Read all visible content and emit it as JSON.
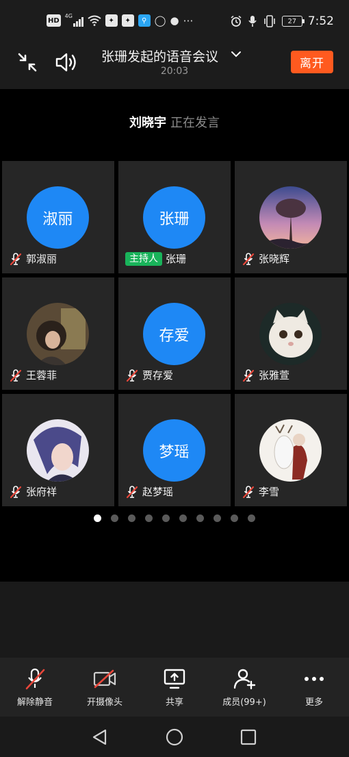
{
  "status_bar": {
    "time": "7:52",
    "battery": "27",
    "network": "4G",
    "hd_badge": "HD",
    "icons_left": [
      "hd-icon",
      "signal-icon",
      "wifi-icon",
      "app-notification-icon",
      "app-notification-icon",
      "search-app-icon",
      "security-app-icon",
      "chat-icon",
      "more-dots-icon"
    ],
    "icons_right": [
      "alarm-icon",
      "mic-icon",
      "vibrate-icon",
      "battery-icon"
    ]
  },
  "header": {
    "title": "张珊发起的语音会议",
    "timer": "20:03",
    "leave_label": "离开"
  },
  "speaker": {
    "name": "刘晓宇",
    "status": "正在发言"
  },
  "participants": [
    {
      "name": "郭淑丽",
      "avatar_text": "淑丽",
      "avatar_type": "text",
      "muted": true
    },
    {
      "name": "张珊",
      "avatar_text": "张珊",
      "avatar_type": "text",
      "muted": false,
      "badge": "主持人"
    },
    {
      "name": "张晓辉",
      "avatar_type": "photo",
      "avatar_subject": "tree-at-dusk",
      "muted": true
    },
    {
      "name": "王蓉菲",
      "avatar_type": "photo",
      "avatar_subject": "girl-portrait",
      "muted": true
    },
    {
      "name": "贾存爱",
      "avatar_text": "存爱",
      "avatar_type": "text",
      "muted": true
    },
    {
      "name": "张雅萱",
      "avatar_type": "photo",
      "avatar_subject": "white-cat",
      "muted": true
    },
    {
      "name": "张府祥",
      "avatar_type": "photo",
      "avatar_subject": "anime-character",
      "muted": true
    },
    {
      "name": "赵梦瑶",
      "avatar_text": "梦瑶",
      "avatar_type": "text",
      "muted": true
    },
    {
      "name": "李雪",
      "avatar_type": "photo",
      "avatar_subject": "illustration-figure-with-deer",
      "muted": true
    }
  ],
  "pagination": {
    "total": 10,
    "current": 1
  },
  "toolbar": [
    {
      "label": "解除静音",
      "icon": "mic-muted-icon"
    },
    {
      "label": "开摄像头",
      "icon": "camera-off-icon"
    },
    {
      "label": "共享",
      "icon": "share-screen-icon"
    },
    {
      "label": "成员(99+)",
      "icon": "add-member-icon"
    },
    {
      "label": "更多",
      "icon": "more-icon"
    }
  ],
  "colors": {
    "accent_blue": "#1e88f5",
    "leave_orange": "#ff5a1f",
    "host_green": "#19b35a",
    "mute_red": "#e8463a"
  }
}
